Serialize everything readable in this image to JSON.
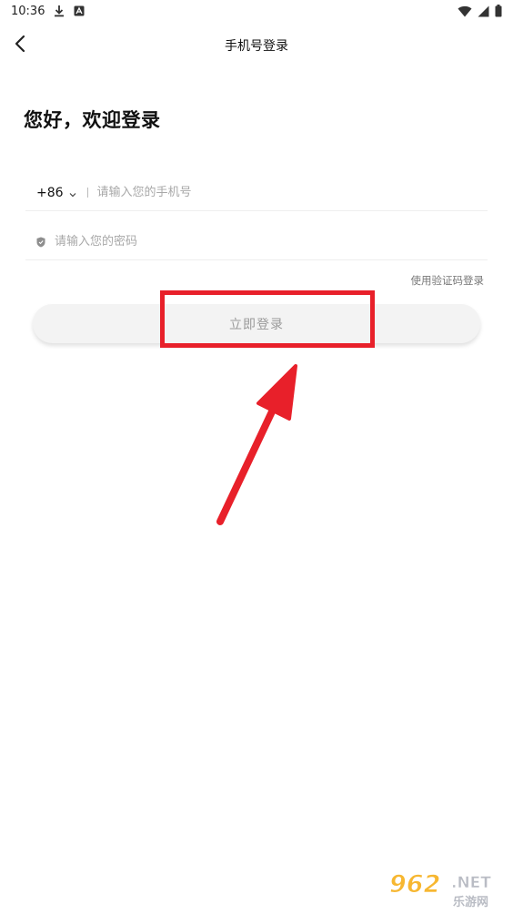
{
  "status_bar": {
    "time": "10:36"
  },
  "nav": {
    "title": "手机号登录"
  },
  "greeting": "您好，欢迎登录",
  "phone": {
    "country_code": "+86",
    "placeholder": "请输入您的手机号"
  },
  "password": {
    "placeholder": "请输入您的密码"
  },
  "sms_login_link": "使用验证码登录",
  "login_button": "立即登录",
  "annotation": {
    "color": "#e8202a"
  },
  "watermark": {
    "logo_text": "962.NET",
    "sub_text": "乐游网"
  }
}
